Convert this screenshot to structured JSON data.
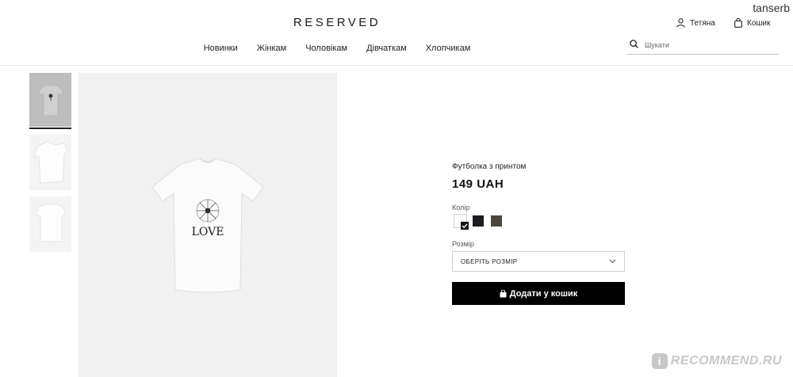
{
  "header": {
    "logo": "RESERVED",
    "user_label": "Тетяна",
    "cart_label": "Кошик",
    "nav": [
      "Новинки",
      "Жінкам",
      "Чоловікам",
      "Дівчаткам",
      "Хлопчикам"
    ],
    "search_placeholder": "Шукати"
  },
  "watermark": {
    "user": "tanserb",
    "site": "RECOMMEND.RU",
    "badge": "i"
  },
  "product": {
    "name": "Футболка з принтом",
    "price": "149 UAH",
    "color_label": "Колір",
    "size_label": "Розмір",
    "size_placeholder": "ОБЕРІТЬ РОЗМІР",
    "add_to_cart": "Додати у кошик",
    "print_text": "LOVE",
    "colors": [
      "#ffffff",
      "#1c1c1e",
      "#4b463f"
    ],
    "selected_color_index": 0
  },
  "icons": {
    "user": "user-icon",
    "cart": "bag-icon",
    "search": "search-icon",
    "chevron": "chevron-down-icon",
    "check": "check-icon"
  }
}
